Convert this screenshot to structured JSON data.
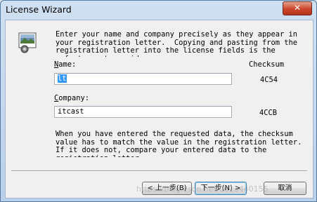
{
  "window": {
    "title": "License Wizard",
    "close_glyph": "✕"
  },
  "intro_text": "Enter your name and company precisely as they appear in\nyour registration letter.  Copying and pasting from the\nregistration letter into the license fields is the\nsafest way to avoid errors.",
  "form": {
    "name_label_underline": "N",
    "name_label_rest": "ame:",
    "name_value": "lt",
    "company_label_underline": "C",
    "company_label_rest": "ompany:",
    "company_value": "itcast",
    "checksum_header": "Checksum",
    "name_checksum": "4C54",
    "company_checksum": "4CCB"
  },
  "outro_text": "When you have entered the requested data, the checksum\nvalue has to match the value in the registration letter.\nIf it does not, compare your entered data to the\nregistration letter.",
  "buttons": {
    "back": "< 上一步(B)",
    "next": "下一步(N) >",
    "cancel": "取消"
  },
  "watermark": "https://blog.csdn.net/u013440155"
}
